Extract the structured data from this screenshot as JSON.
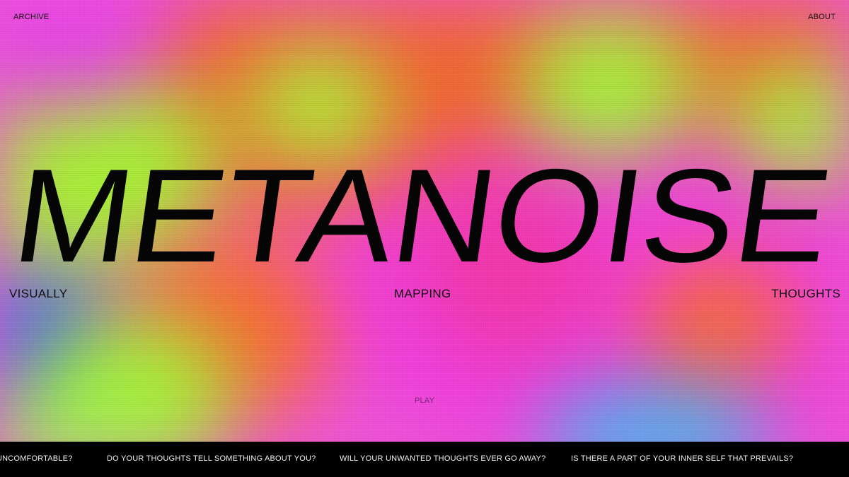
{
  "nav": {
    "archive_label": "ARCHIVE",
    "about_label": "ABOUT"
  },
  "hero": {
    "title": "METANOISE",
    "taglines": [
      "VISUALLY",
      "MAPPING",
      "THOUGHTS"
    ]
  },
  "controls": {
    "play_label": "PLAY"
  },
  "ticker": {
    "items": [
      "UNCOMFORTABLE?",
      "DO YOUR THOUGHTS TELL SOMETHING ABOUT YOU?",
      "WILL YOUR UNWANTED THOUGHTS EVER GO AWAY?",
      "IS THERE A PART OF YOUR INNER SELF THAT PREVAILS?"
    ]
  },
  "colors": {
    "magenta": "#ee3dde",
    "orange": "#f26535",
    "lime": "#a8f033",
    "blue": "#2a6ee8",
    "cyan": "#3fb9f0",
    "text": "#050505",
    "ticker_bg": "#000000",
    "ticker_text": "#f2f2f2"
  }
}
